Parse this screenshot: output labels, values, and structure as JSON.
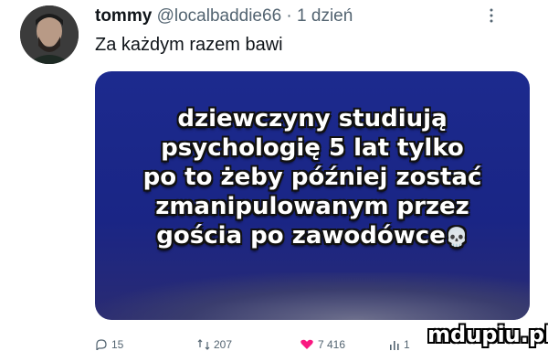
{
  "tweet": {
    "author_name": "tommy",
    "handle": "@localbaddie66",
    "separator": "·",
    "time": "1 dzień",
    "text": "Za każdym razem bawi",
    "more_icon": "more-icon"
  },
  "media": {
    "caption_lines": [
      "dziewczyny studiują",
      "psychologię 5 lat tylko",
      "po to żeby później zostać",
      "zmanipulowanym przez",
      "gościa po zawodówce"
    ],
    "emoji": "💀",
    "background_color": "#1c2a8e"
  },
  "actions": {
    "reply_count": "15",
    "retweet_count": "207",
    "like_count": "7 416",
    "views_count": "1"
  },
  "watermark": {
    "text": "mdupiu.pl"
  }
}
